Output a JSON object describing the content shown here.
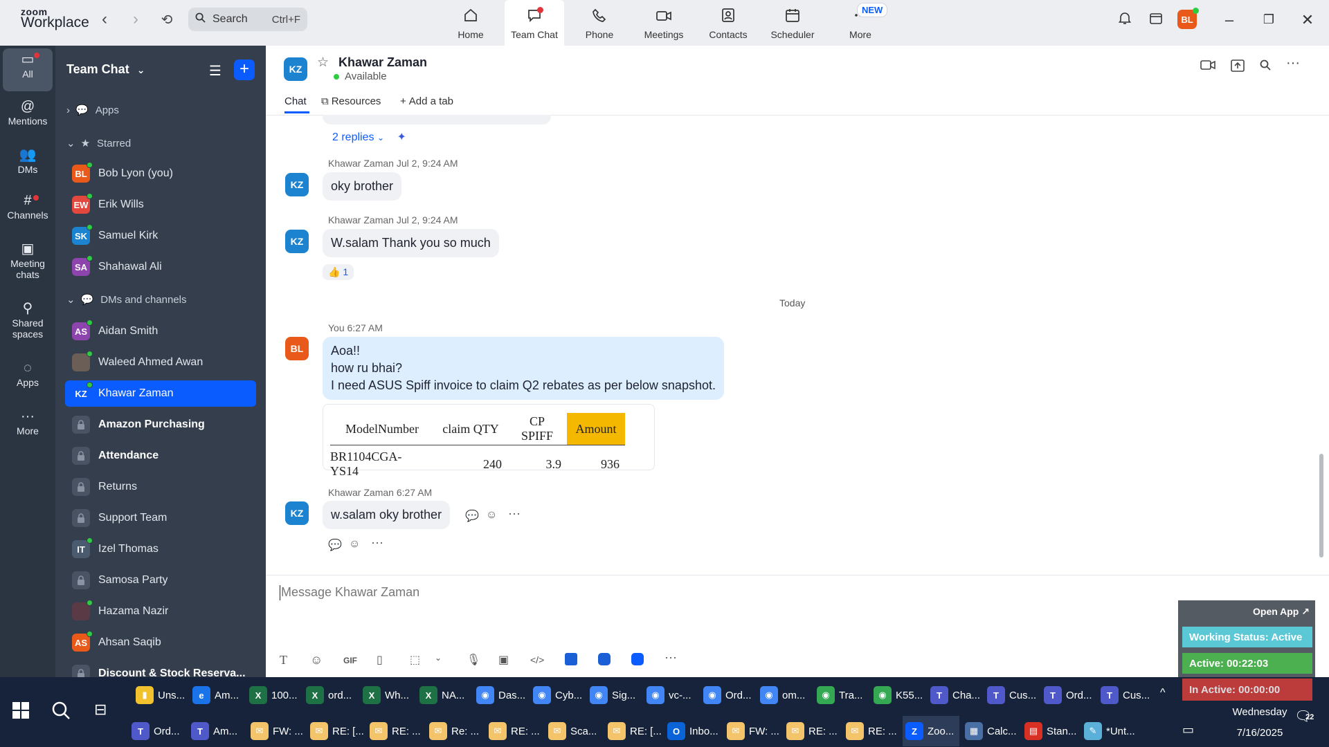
{
  "app": {
    "logo_top": "zoom",
    "logo_bottom": "Workplace"
  },
  "search": {
    "placeholder": "Search",
    "shortcut": "Ctrl+F"
  },
  "top_tabs": [
    {
      "label": "Home",
      "icon": "home-icon"
    },
    {
      "label": "Team Chat",
      "icon": "chat-icon"
    },
    {
      "label": "Phone",
      "icon": "phone-icon"
    },
    {
      "label": "Meetings",
      "icon": "video-icon"
    },
    {
      "label": "Contacts",
      "icon": "contacts-icon"
    },
    {
      "label": "Scheduler",
      "icon": "calendar-icon"
    },
    {
      "label": "More",
      "icon": "more-icon"
    }
  ],
  "new_badge": "NEW",
  "user_initials": "BL",
  "rail": [
    {
      "label": "All"
    },
    {
      "label": "Mentions"
    },
    {
      "label": "DMs"
    },
    {
      "label": "Channels"
    },
    {
      "label": "Meeting chats"
    },
    {
      "label": "Shared spaces"
    },
    {
      "label": "Apps"
    },
    {
      "label": "More"
    }
  ],
  "sidebar": {
    "title": "Team Chat",
    "sections": {
      "apps": "Apps",
      "starred": "Starred",
      "dms": "DMs and channels"
    },
    "starred": [
      {
        "initials": "BL",
        "name": "Bob Lyon (you)",
        "color": "#e8591a"
      },
      {
        "initials": "EW",
        "name": "Erik Wills",
        "color": "#e2483d"
      },
      {
        "initials": "SK",
        "name": "Samuel Kirk",
        "color": "#1c83d0"
      },
      {
        "initials": "SA",
        "name": "Shahawal Ali",
        "color": "#8e44ad"
      }
    ],
    "channels": [
      {
        "initials": "AS",
        "name": "Aidan Smith",
        "type": "person",
        "color": "#8e44ad"
      },
      {
        "initials": "",
        "name": "Waleed Ahmed Awan",
        "type": "photo",
        "color": "#6b5e57"
      },
      {
        "initials": "KZ",
        "name": "Khawar Zaman",
        "type": "person",
        "color": "#1c83d0"
      },
      {
        "initials": "",
        "name": "Amazon Purchasing",
        "type": "lock"
      },
      {
        "initials": "",
        "name": "Attendance",
        "type": "lock"
      },
      {
        "initials": "",
        "name": "Returns",
        "type": "lock"
      },
      {
        "initials": "",
        "name": "Support Team",
        "type": "lock"
      },
      {
        "initials": "IT",
        "name": "Izel Thomas",
        "type": "person",
        "color": "#4a5b70"
      },
      {
        "initials": "",
        "name": "Samosa Party",
        "type": "lock"
      },
      {
        "initials": "",
        "name": "Hazama Nazir",
        "type": "photo",
        "color": "#5a3a44"
      },
      {
        "initials": "AS",
        "name": "Ahsan Saqib",
        "type": "person",
        "color": "#e8591a"
      },
      {
        "initials": "",
        "name": "Discount & Stock Reserva...",
        "type": "lock"
      }
    ]
  },
  "chat": {
    "contact_initials": "KZ",
    "contact_name": "Khawar Zaman",
    "status": "Available",
    "tabs": {
      "chat": "Chat",
      "resources": "Resources",
      "add": "Add a tab"
    },
    "replies": "2 replies",
    "messages": [
      {
        "sender": "Khawar Zaman",
        "time": "Jul 2, 9:24 AM",
        "text": "oky brother"
      },
      {
        "sender": "Khawar Zaman",
        "time": "Jul 2, 9:24 AM",
        "text": "W.salam Thank you so much",
        "reaction": "👍 1"
      }
    ],
    "divider": "Today",
    "my_message": {
      "sender": "You",
      "time": "6:27 AM",
      "initials": "BL",
      "lines": [
        "Aoa!!",
        "how ru bhai?",
        "I need ASUS Spiff invoice to claim Q2 rebates as per below snapshot."
      ]
    },
    "snapshot": {
      "headers": [
        "ModelNumber",
        "claim QTY",
        "CP SPIFF",
        "Amount"
      ],
      "row": [
        "BR1104CGA-YS14",
        "240",
        "3.9",
        "936"
      ]
    },
    "last_message": {
      "sender": "Khawar Zaman",
      "time": "6:27 AM",
      "text": "w.salam oky brother"
    },
    "composer_placeholder": "Message Khawar Zaman"
  },
  "widget": {
    "open_app": "Open App ↗",
    "working": "Working Status: Active",
    "active": "Active: 00:22:03",
    "inactive": "In Active: 00:00:00"
  },
  "taskbar": {
    "row1": [
      {
        "label": "Uns...",
        "color": "#f2c12e",
        "glyph": "▮"
      },
      {
        "label": "Am...",
        "color": "#1a73e8",
        "glyph": "e"
      },
      {
        "label": "100...",
        "color": "#1e7145",
        "glyph": "X"
      },
      {
        "label": "ord...",
        "color": "#1e7145",
        "glyph": "X"
      },
      {
        "label": "Wh...",
        "color": "#1e7145",
        "glyph": "X"
      },
      {
        "label": "NA...",
        "color": "#1e7145",
        "glyph": "X"
      },
      {
        "label": "Das...",
        "color": "#4285f4",
        "glyph": "◉"
      },
      {
        "label": "Cyb...",
        "color": "#4285f4",
        "glyph": "◉"
      },
      {
        "label": "Sig...",
        "color": "#4285f4",
        "glyph": "◉"
      },
      {
        "label": "vc-...",
        "color": "#4285f4",
        "glyph": "◉"
      },
      {
        "label": "Ord...",
        "color": "#4285f4",
        "glyph": "◉"
      },
      {
        "label": "om...",
        "color": "#4285f4",
        "glyph": "◉"
      },
      {
        "label": "Tra...",
        "color": "#34a853",
        "glyph": "◉"
      },
      {
        "label": "K55...",
        "color": "#34a853",
        "glyph": "◉"
      },
      {
        "label": "Cha...",
        "color": "#5059c9",
        "glyph": "T"
      },
      {
        "label": "Cus...",
        "color": "#5059c9",
        "glyph": "T"
      },
      {
        "label": "Ord...",
        "color": "#5059c9",
        "glyph": "T"
      },
      {
        "label": "Cus...",
        "color": "#5059c9",
        "glyph": "T"
      }
    ],
    "row2": [
      {
        "label": "Ord...",
        "color": "#5059c9",
        "glyph": "T"
      },
      {
        "label": "Am...",
        "color": "#5059c9",
        "glyph": "T"
      },
      {
        "label": "FW: ...",
        "color": "#f3c46a",
        "glyph": "✉"
      },
      {
        "label": "RE: [...",
        "color": "#f3c46a",
        "glyph": "✉"
      },
      {
        "label": "RE: ...",
        "color": "#f3c46a",
        "glyph": "✉"
      },
      {
        "label": "Re: ...",
        "color": "#f3c46a",
        "glyph": "✉"
      },
      {
        "label": "RE: ...",
        "color": "#f3c46a",
        "glyph": "✉"
      },
      {
        "label": "Sca...",
        "color": "#f3c46a",
        "glyph": "✉"
      },
      {
        "label": "RE: [...",
        "color": "#f3c46a",
        "glyph": "✉"
      },
      {
        "label": "Inbo...",
        "color": "#0a64d8",
        "glyph": "O"
      },
      {
        "label": "FW: ...",
        "color": "#f3c46a",
        "glyph": "✉"
      },
      {
        "label": "RE: ...",
        "color": "#f3c46a",
        "glyph": "✉"
      },
      {
        "label": "RE: ...",
        "color": "#f3c46a",
        "glyph": "✉"
      },
      {
        "label": "Zoo...",
        "color": "#0b5cff",
        "glyph": "Z"
      },
      {
        "label": "Calc...",
        "color": "#4a6fa5",
        "glyph": "▦"
      },
      {
        "label": "Stan...",
        "color": "#d93025",
        "glyph": "▤"
      },
      {
        "label": "*Unt...",
        "color": "#5ab0d8",
        "glyph": "✎"
      }
    ],
    "day": "Wednesday",
    "date": "7/16/2025",
    "notifications": "22"
  }
}
